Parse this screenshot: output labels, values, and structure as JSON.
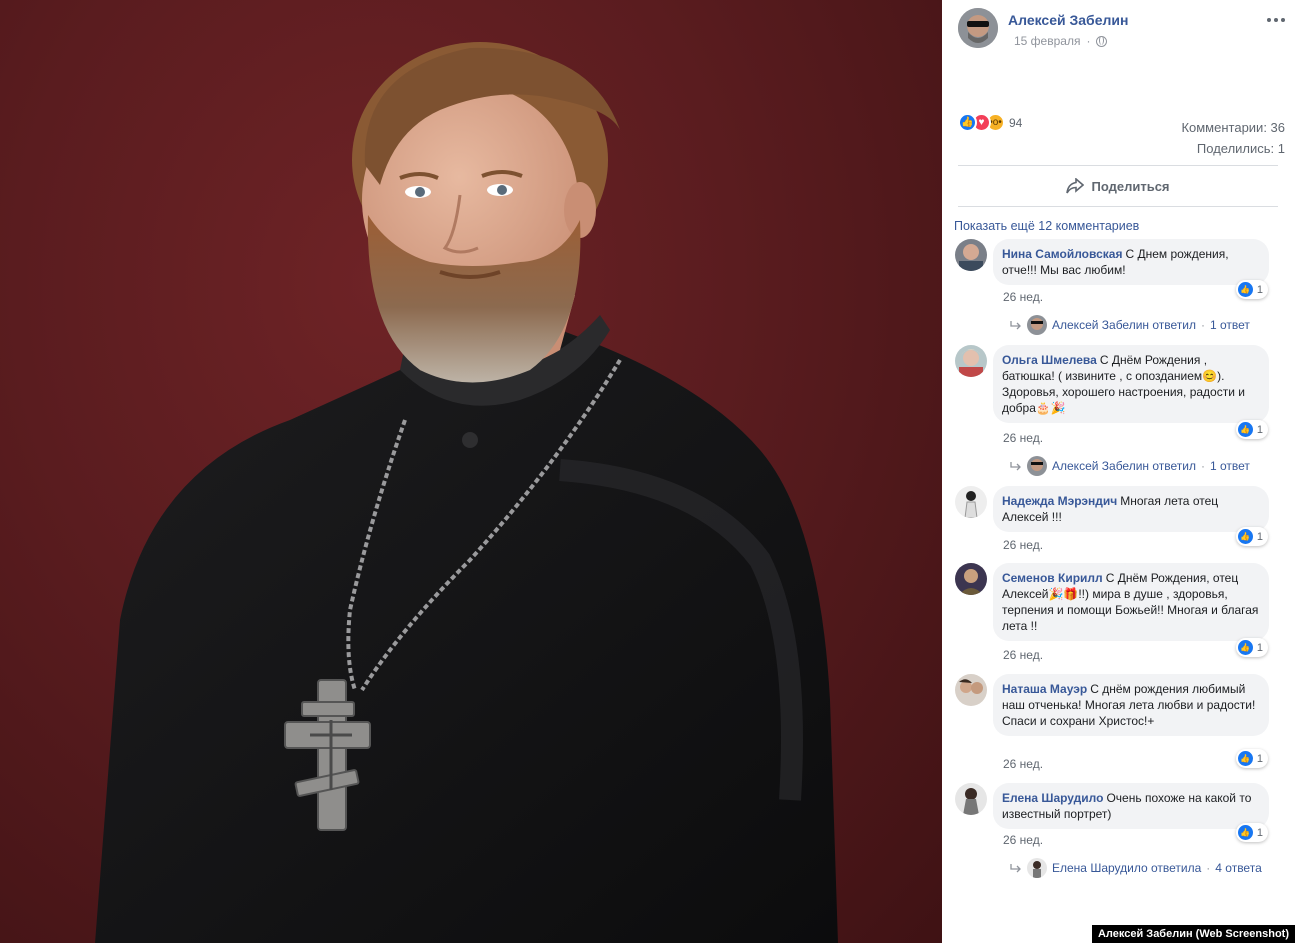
{
  "post": {
    "author": "Алексей Забелин",
    "date": "15 февраля",
    "reactions_count": "94",
    "comments_stat": "Комментарии: 36",
    "shares_stat": "Поделились: 1",
    "share_label": "Поделиться"
  },
  "show_more_label": "Показать ещё 12 комментариев",
  "comments": [
    {
      "name": "Нина Самойловская",
      "text": "С Днем рождения, отче!!! Мы вас любим!",
      "likes": "1",
      "time": "26 нед.",
      "reply": {
        "who": "Алексей Забелин ответил",
        "count": "1 ответ"
      }
    },
    {
      "name": "Ольга Шмелева",
      "text": "С Днём Рождения , батюшка! ( извините , с опозданием😊). Здоровья, хорошего настроения, радости и добра🎂🎉",
      "likes": "1",
      "time": "26 нед.",
      "reply": {
        "who": "Алексей Забелин ответил",
        "count": "1 ответ"
      }
    },
    {
      "name": "Надежда Мэрэндич",
      "text": "Многая лета отец Алексей !!!",
      "likes": "1",
      "time": "26 нед."
    },
    {
      "name": "Семенов Кирилл",
      "text": "С Днём Рождения, отец Алексей🎉🎁!!) мира в душе , здоровья, терпения и помощи Божьей!! Многая и благая лета !!",
      "likes": "1",
      "time": "26 нед."
    },
    {
      "name": "Наташа Мауэр",
      "text": "С днём рождения любимый наш отченька! Многая лета любви и радости! Спаси и сохрани Христос!+",
      "likes": "1",
      "time": "26 нед."
    },
    {
      "name": "Елена Шарудило",
      "text": "Очень похоже на какой то известный портрет)",
      "likes": "1",
      "time": "26 нед.",
      "reply": {
        "who": "Елена Шарудило ответила",
        "count": "4 ответа"
      }
    }
  ],
  "separator": "·",
  "credit": "Алексей Забелин (Web Screenshot)",
  "colors": {
    "link": "#385898",
    "like": "#1877f2",
    "love": "#f33e58",
    "wow": "#f7b125",
    "backdrop": "#5a1c1f"
  },
  "icons": [
    "more-icon",
    "globe-icon",
    "share-icon",
    "like-icon",
    "love-icon",
    "wow-icon",
    "reply-arrow-icon"
  ]
}
